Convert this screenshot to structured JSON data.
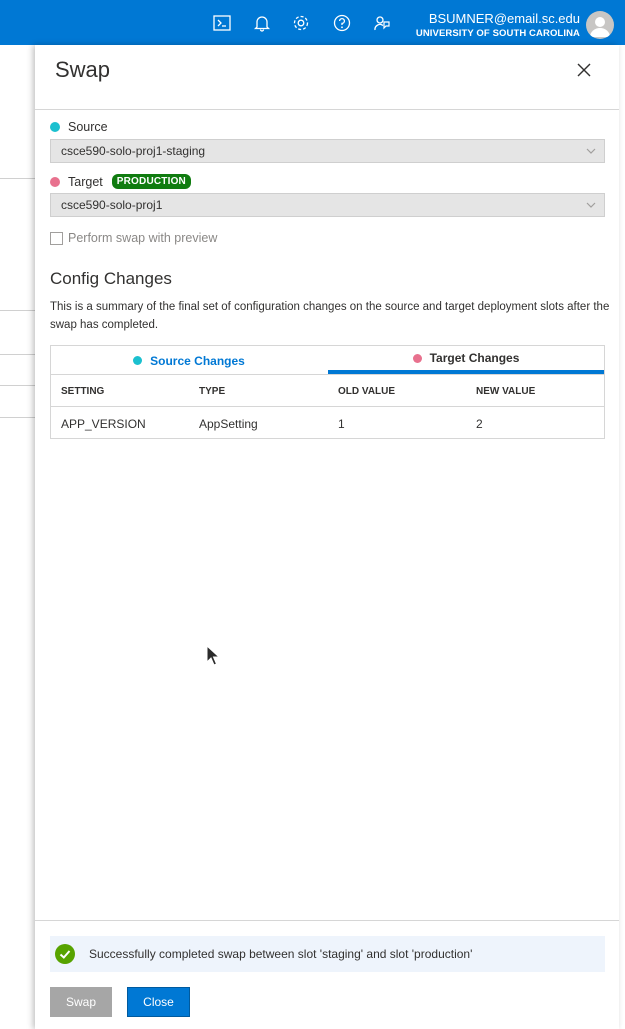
{
  "topbar": {
    "icons": [
      "cloud-shell-icon",
      "notifications-icon",
      "settings-icon",
      "help-icon",
      "feedback-icon"
    ],
    "user_email": "BSUMNER@email.sc.edu",
    "user_org": "UNIVERSITY OF SOUTH CAROLINA"
  },
  "blade": {
    "title": "Swap",
    "source": {
      "label": "Source",
      "dot_color": "#1bc0cf",
      "value": "csce590-solo-proj1-staging"
    },
    "target": {
      "label": "Target",
      "dot_color": "#e8718e",
      "badge": "PRODUCTION",
      "value": "csce590-solo-proj1"
    },
    "preview_checkbox": {
      "label": "Perform swap with preview",
      "checked": false
    },
    "config": {
      "title": "Config Changes",
      "description": "This is a summary of the final set of configuration changes on the source and target deployment slots after the swap has completed.",
      "tabs": [
        {
          "label": "Source Changes",
          "selected": false
        },
        {
          "label": "Target Changes",
          "selected": true
        }
      ],
      "columns": [
        "SETTING",
        "TYPE",
        "OLD VALUE",
        "NEW VALUE"
      ],
      "rows": [
        [
          "APP_VERSION",
          "AppSetting",
          "1",
          "2"
        ]
      ]
    },
    "notice": "Successfully completed swap between slot 'staging' and slot 'production'",
    "buttons": {
      "swap": "Swap",
      "close": "Close"
    }
  },
  "colors": {
    "accent": "#0078d4",
    "success": "#107c10"
  }
}
